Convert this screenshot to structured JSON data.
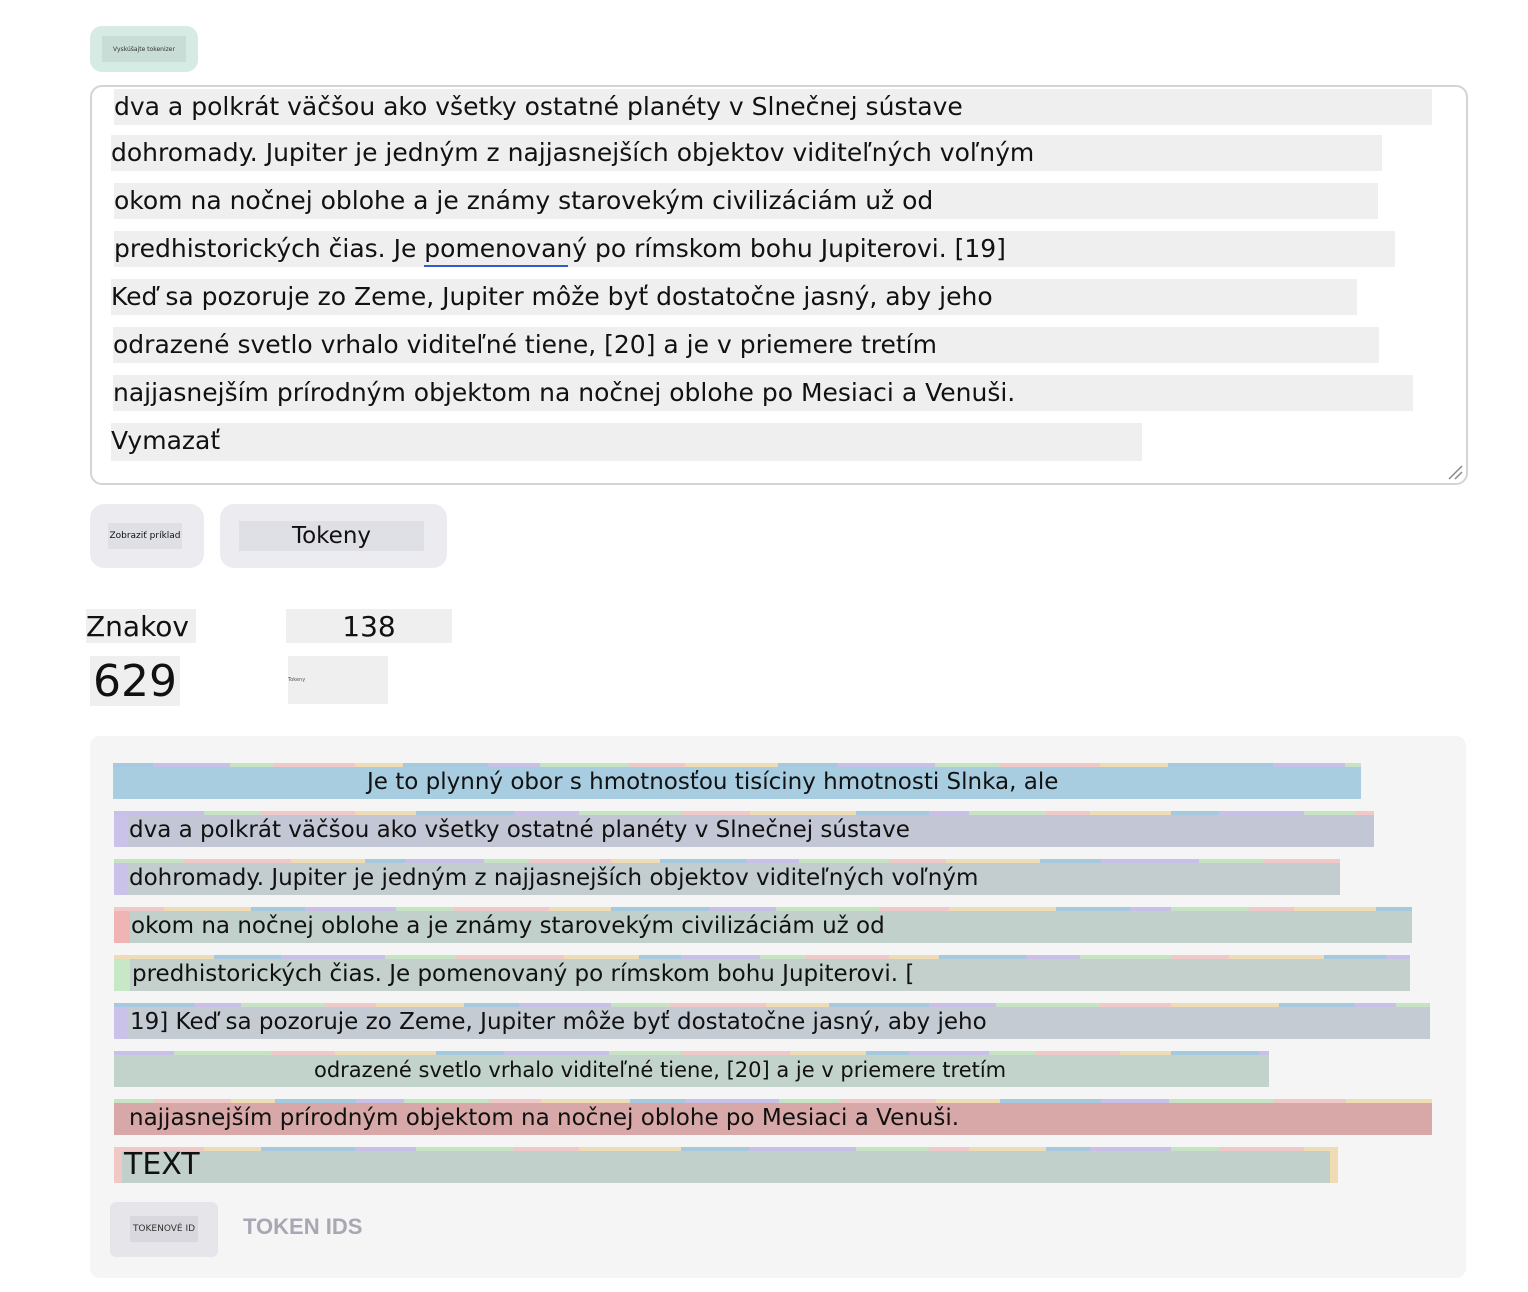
{
  "header": {
    "badge_label": "Vyskúšajte tokenizer"
  },
  "editor": {
    "lines": [
      "dva a polkrát väčšou ako všetky ostatné planéty v Slnečnej sústave",
      "dohromady. Jupiter je jedným z najjasnejších objektov viditeľných voľným",
      "okom na nočnej oblohe a je známy starovekým civilizáciám už od",
      "predhistorických čias. Je pomenovaný po rímskom bohu Jupiterovi. [19]",
      "Keď sa pozoruje zo Zeme, Jupiter môže byť dostatočne jasný, aby jeho",
      "odrazené svetlo vrhalo viditeľné tiene, [20] a je v priemere tretím",
      "najjasnejším prírodným objektom na nočnej oblohe po Mesiaci a Venuši.",
      "Vymazať"
    ]
  },
  "buttons": {
    "show_example": "Zobraziť príklad",
    "tokens": "Tokeny"
  },
  "stats": {
    "chars_label": "Znakov",
    "tokens_value": "138",
    "chars_value": "629",
    "tokens_label": "Tokeny"
  },
  "tokens": {
    "lines": [
      "Je to plynný obor s hmotnosťou tisíciny hmotnosti Slnka, ale",
      "dva a polkrát väčšou ako všetky ostatné planéty v Slnečnej sústave",
      "dohromady. Jupiter je jedným z najjasnejších objektov viditeľných voľným",
      "okom na nočnej oblohe a je známy starovekým civilizáciám už od",
      "predhistorických čias. Je pomenovaný po rímskom bohu Jupiterovi. [",
      "19] Keď sa pozoruje zo Zeme, Jupiter môže byť dostatočne jasný, aby jeho",
      "odrazené svetlo vrhalo viditeľné tiene, [20] a je v priemere tretím",
      "najjasnejším prírodným objektom na nočnej oblohe po Mesiaci a Venuši.",
      "TEXT"
    ],
    "token_colors": [
      "#a7c9e0",
      "#c9c0e8",
      "#c7e3c3",
      "#f0c8c8",
      "#f0dcb4"
    ]
  },
  "footer": {
    "token_ids_button": "TOKENOVÉ ID",
    "token_ids_label": "TOKEN IDS"
  }
}
